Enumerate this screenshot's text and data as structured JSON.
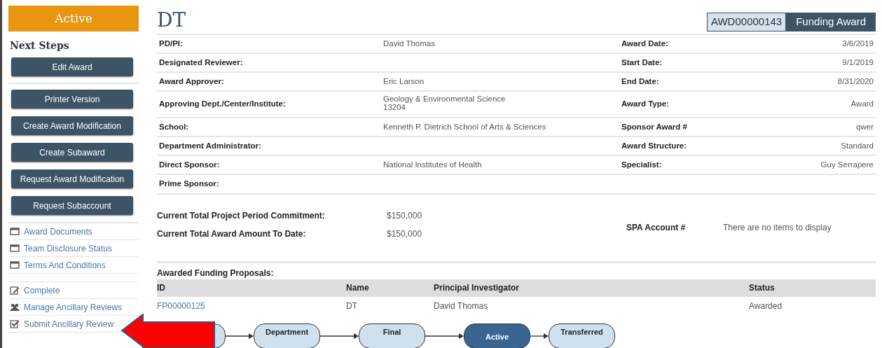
{
  "state_banner": "Active",
  "next_steps": {
    "title": "Next Steps",
    "buttons": [
      "Edit Award",
      "Printer Version",
      "Create Award Modification",
      "Create Subaward",
      "Request Award Modification",
      "Request Subaccount"
    ],
    "links": [
      {
        "label": "Award Documents",
        "kind": "table"
      },
      {
        "label": "Team Disclosure Status",
        "kind": "table"
      },
      {
        "label": "Terms And Conditions",
        "kind": "table"
      }
    ],
    "actions": [
      {
        "label": "Complete",
        "kind": "edit"
      },
      {
        "label": "Manage Ancillary Reviews",
        "kind": "people"
      },
      {
        "label": "Submit Ancillary Review",
        "kind": "check"
      }
    ]
  },
  "record": {
    "title": "DT",
    "id": "AWD00000143",
    "type": "Funding Award"
  },
  "details": [
    {
      "label": "PD/PI:",
      "value": "David Thomas",
      "label_2": "Award Date:",
      "value_2": "3/6/2019"
    },
    {
      "label": "Designated Reviewer:",
      "label_2": "Start Date:",
      "value_2": "9/1/2019"
    },
    {
      "label": "Award Approver:",
      "value": "Eric Larson",
      "label_2": "End Date:",
      "value_2": "8/31/2020"
    },
    {
      "label": "Approving Dept./Center/Institute:",
      "value": "Geology & Environmental Science\n13204",
      "label_2": "Award Type:",
      "value_2": "Award"
    },
    {
      "label": "School:",
      "value": "Kenneth P. Dietrich School of Arts & Sciences",
      "label_2": "Sponsor Award #",
      "value_2": "qwer"
    },
    {
      "label": "Department Administrator:",
      "label_2": "Award Structure:",
      "value_2": "Standard"
    },
    {
      "label": "Direct Sponsor:",
      "value": "National Institutes of Health",
      "label_2": "Specialist:",
      "value_2": "Guy Serrapere"
    },
    {
      "label": "Prime Sponsor:"
    }
  ],
  "totals": [
    {
      "label": "Current Total Project Period Commitment:",
      "value": "$150,000"
    },
    {
      "label": "Current Total Award Amount To Date:",
      "value": "$150,000"
    }
  ],
  "spa_account": {
    "label": "SPA Account #",
    "value": "There are no items to display"
  },
  "proposals": {
    "title": "Awarded Funding Proposals:",
    "columns": [
      "ID",
      "Name",
      "Principal Investigator",
      "Status"
    ],
    "rows": [
      {
        "cells": [
          "FP00000125",
          "DT",
          "David Thomas",
          "Awarded"
        ]
      }
    ]
  },
  "workflow": {
    "nodes": [
      {
        "selected": false
      },
      {
        "label": "Department",
        "selected": false
      },
      {
        "label": "Final",
        "selected": false
      },
      {
        "label": "Active",
        "selected": true
      },
      {
        "label": "Transferred",
        "selected": false
      }
    ]
  }
}
